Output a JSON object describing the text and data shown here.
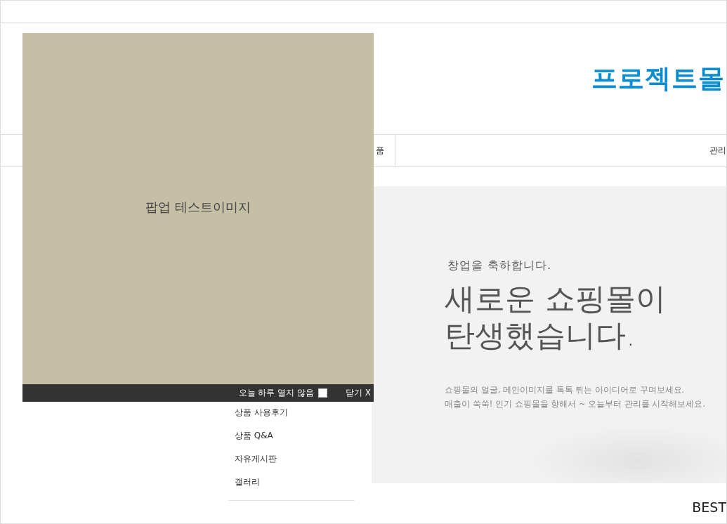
{
  "header": {
    "logo": "프로젝트몰"
  },
  "nav": {
    "items": [
      {
        "label": "품"
      },
      {
        "label": "관리"
      }
    ]
  },
  "board_menu": {
    "items": [
      "상품 사용후기",
      "상품 Q&A",
      "자유게시판",
      "갤러리"
    ]
  },
  "banner": {
    "kicker": "창업을 축하합니다.",
    "headline": [
      "새로운 쇼핑몰이",
      "탄생했습니다."
    ],
    "body": [
      "쇼핑몰의 얼굴, 메인이미지를 톡톡 튀는 아이디어로 꾸며보세요.",
      "매출이 쑥쑥! 인기 쇼핑몰을 향해서 ~ 오늘부터 관리를 시작해보세요."
    ]
  },
  "section_title": "BEST",
  "popup": {
    "image_text": "팝업 테스트이미지",
    "dont_show_label": "오늘 하루 열지 않음",
    "dont_show_checked": false,
    "close_label": "닫기 X"
  }
}
